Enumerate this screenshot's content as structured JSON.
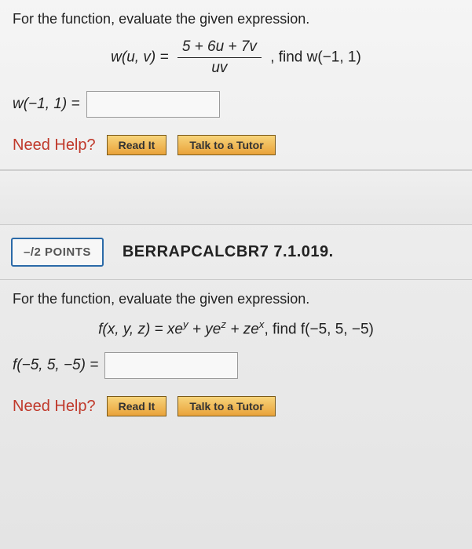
{
  "q1": {
    "prompt": "For the function, evaluate the given expression.",
    "func_lhs": "w(u, v) = ",
    "frac_num": "5 + 6u + 7v",
    "frac_den": "uv",
    "find_text": ", find w(−1, 1)",
    "answer_label": "w(−1, 1) =",
    "answer_value": "",
    "help_label": "Need Help?",
    "read_label": "Read It",
    "tutor_label": "Talk to a Tutor"
  },
  "points": {
    "badge": "–/2 POINTS",
    "assignment_id": "BERRAPCALCBR7 7.1.019."
  },
  "q2": {
    "prompt": "For the function, evaluate the given expression.",
    "func_prefix": "f(x, y, z) = xe",
    "exp1": "y",
    "mid1": " + ye",
    "exp2": "z",
    "mid2": " + ze",
    "exp3": "x",
    "find_text": ", find f(−5, 5, −5)",
    "answer_label": "f(−5, 5, −5) =",
    "answer_value": "",
    "help_label": "Need Help?",
    "read_label": "Read It",
    "tutor_label": "Talk to a Tutor"
  }
}
